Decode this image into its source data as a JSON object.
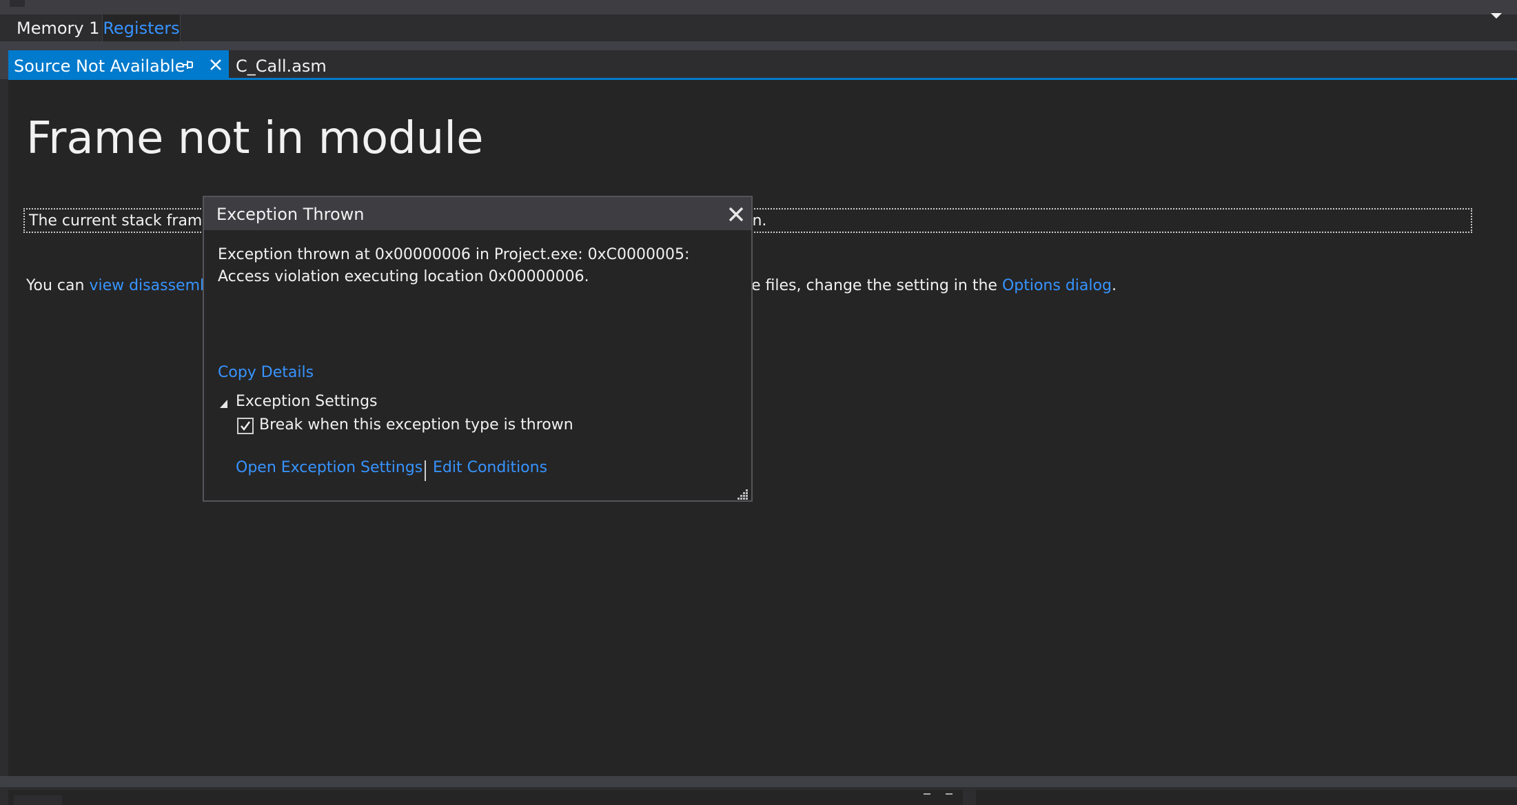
{
  "tool_tabs": {
    "memory": "Memory 1",
    "registers": "Registers"
  },
  "doc_tabs": {
    "active": "Source Not Available",
    "second": "C_Call.asm"
  },
  "content": {
    "title": "Frame not in module",
    "info_text_start": "The current stack frame",
    "info_text_end": "on.",
    "you_can": "You can",
    "view_disassembly_link": "view disassemb",
    "change_text": "e files, change the setting in the",
    "options_link": "Options dialog",
    "period": "."
  },
  "popup": {
    "title": "Exception Thrown",
    "message": "Exception thrown at 0x00000006 in Project.exe: 0xC0000005: Access violation executing location 0x00000006.",
    "copy_details": "Copy Details",
    "settings_heading": "Exception Settings",
    "checkbox_label": "Break when this exception type is thrown",
    "checkbox_checked": true,
    "open_settings": "Open Exception Settings",
    "edit_conditions": "Edit Conditions"
  },
  "colors": {
    "accent": "#007acc",
    "link": "#3794ff",
    "background": "#252526"
  },
  "icons": {
    "pin": "pin-icon",
    "close": "close-icon",
    "dropdown": "chevron-down-icon",
    "toggle": "triangle-expanded-icon",
    "grip": "resize-grip-icon"
  }
}
